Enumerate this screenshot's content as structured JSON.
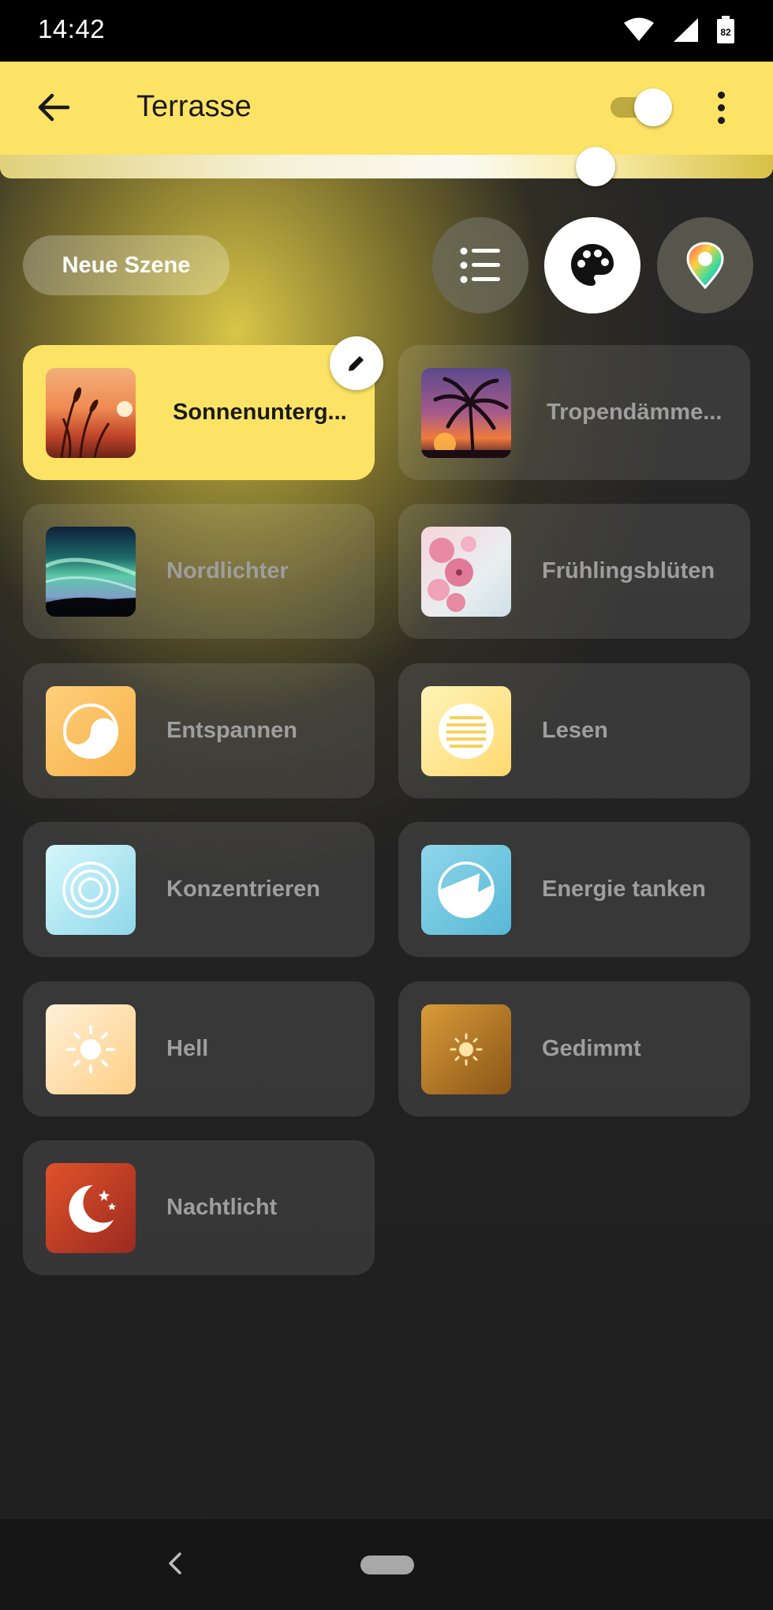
{
  "status_bar": {
    "time": "14:42",
    "battery": "82"
  },
  "app_bar": {
    "title": "Terrasse",
    "power_on": true,
    "brightness_fraction": 0.77
  },
  "toolbar": {
    "new_scene_label": "Neue Szene",
    "selected_view": "palette"
  },
  "scenes": [
    {
      "label": "Sonnenunterg...",
      "active": true,
      "thumb": "sunset-grass-photo"
    },
    {
      "label": "Tropendämme...",
      "active": false,
      "thumb": "palm-dusk-photo"
    },
    {
      "label": "Nordlichter",
      "active": false,
      "thumb": "aurora-photo"
    },
    {
      "label": "Frühlingsblüten",
      "active": false,
      "thumb": "blossom-photo"
    },
    {
      "label": "Entspannen",
      "active": false,
      "thumb": "relax-icon"
    },
    {
      "label": "Lesen",
      "active": false,
      "thumb": "read-icon"
    },
    {
      "label": "Konzentrieren",
      "active": false,
      "thumb": "concentrate-icon"
    },
    {
      "label": "Energie tanken",
      "active": false,
      "thumb": "energize-icon"
    },
    {
      "label": "Hell",
      "active": false,
      "thumb": "bright-sun-icon"
    },
    {
      "label": "Gedimmt",
      "active": false,
      "thumb": "dimmed-sun-icon"
    },
    {
      "label": "Nachtlicht",
      "active": false,
      "thumb": "nightlight-moon-icon"
    }
  ],
  "colors": {
    "accent": "#fde365",
    "background": "#1f1f1f",
    "card": "#3a3a3a",
    "label_inactive": "#9e9e9e"
  }
}
